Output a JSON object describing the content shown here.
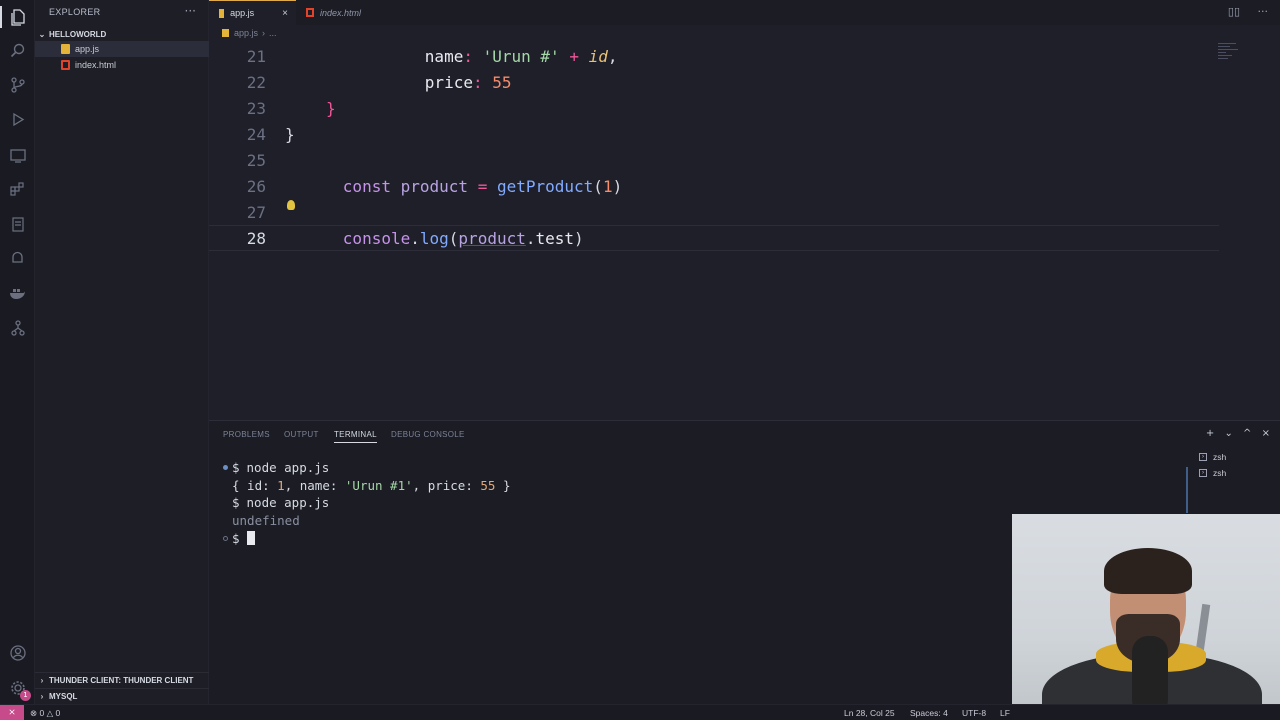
{
  "sidebar": {
    "title": "EXPLORER",
    "more": "···",
    "folder": "HELLOWORLD",
    "files": [
      {
        "name": "app.js",
        "type": "js"
      },
      {
        "name": "index.html",
        "type": "html"
      }
    ],
    "bottom_sections": [
      "THUNDER CLIENT: THUNDER CLIENT",
      "MYSQL"
    ]
  },
  "tabs": [
    {
      "label": "app.js",
      "close": "×"
    },
    {
      "label": "index.html"
    }
  ],
  "breadcrumb": {
    "file": "app.js",
    "more": "..."
  },
  "editor": {
    "lines": [
      {
        "num": "21"
      },
      {
        "num": "22"
      },
      {
        "num": "23"
      },
      {
        "num": "24"
      },
      {
        "num": "25"
      },
      {
        "num": "26"
      },
      {
        "num": "27"
      },
      {
        "num": "28"
      }
    ],
    "tokens": {
      "name_key": "name",
      "colon": ":",
      "str_urun": "'Urun #'",
      "plus": "+",
      "id": "id",
      "comma": ",",
      "price_key": "price",
      "price_val": "55",
      "close_brace": "}",
      "const_kw": "const",
      "product_var": "product",
      "eq": "=",
      "get_fn": "getProduct",
      "lparen": "(",
      "arg": "1",
      "rparen": ")",
      "console": "console",
      "dot": ".",
      "log": "log",
      "product_arg": "product",
      "test": "test"
    }
  },
  "panel": {
    "tabs": [
      "PROBLEMS",
      "OUTPUT",
      "TERMINAL",
      "DEBUG CONSOLE"
    ],
    "active_tab": "TERMINAL",
    "controls": [
      "+",
      "⌄",
      "^",
      "×"
    ],
    "terminal": {
      "prompt": "$",
      "cmd1": "node app.js",
      "out1_open": "{ id: ",
      "out1_id": "1",
      "out1_mid": ", name: ",
      "out1_name": "'Urun #1'",
      "out1_mid2": ", price: ",
      "out1_price": "55",
      "out1_close": " }",
      "cmd2": "node app.js",
      "out2": "undefined"
    },
    "shells": [
      "zsh",
      "zsh"
    ]
  },
  "status": {
    "remote": "⨯",
    "errors": "⊗ 0 △ 0",
    "position": "Ln 28, Col 25",
    "spaces": "Spaces: 4",
    "encoding": "UTF-8",
    "eol": "LF"
  },
  "activity_icons": [
    "files-icon",
    "search-icon",
    "source-control-icon",
    "run-debug-icon",
    "remote-explorer-icon",
    "extensions-icon",
    "database-icon",
    "thunder-client-icon",
    "docker-icon",
    "git-graph-icon",
    "account-icon",
    "settings-icon"
  ]
}
